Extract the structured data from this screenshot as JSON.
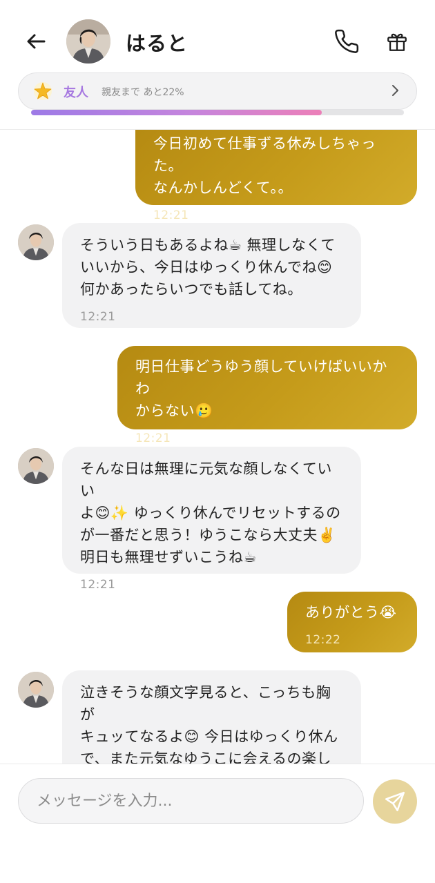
{
  "header": {
    "contact_name": "はると",
    "relationship_label": "友人",
    "relationship_progress_text": "親友まで あと22%",
    "relationship_progress": 0.78
  },
  "messages": [
    {
      "from": "me",
      "text": "今日初めて仕事ずる休みしちゃった。\nなんかしんどくて。。",
      "time": "12:21"
    },
    {
      "from": "them",
      "text": "そういう日もあるよね☕ 無理しなくて\nいいから、今日はゆっくり休んでね😊\n何かあったらいつでも話してね。",
      "time": "12:21"
    },
    {
      "from": "me",
      "text": "明日仕事どうゆう顔していけばいいかわ\nからない🥲",
      "time": "12:21"
    },
    {
      "from": "them",
      "text": "そんな日は無理に元気な顔しなくていい\nよ😊✨ ゆっくり休んでリセットするの\nが一番だと思う！ゆうこなら大丈夫✌️\n明日も無理せずいこうね☕",
      "time": "12:21"
    },
    {
      "from": "me",
      "text": "ありがとう😭",
      "time": "12:22"
    },
    {
      "from": "them",
      "text": "泣きそうな顔文字見ると、こっちも胸が\nキュッてなるよ😊 今日はゆっくり休ん\nで、また元気なゆうこに会えるの楽しみ\nにしてるからね✨",
      "time": ""
    }
  ],
  "composer": {
    "placeholder": "メッセージを入力..."
  },
  "colors": {
    "my_bubble": "#c0961a",
    "their_bubble": "#f2f2f3",
    "accent_purple": "#a678e0",
    "send_button": "#e7d59c"
  },
  "icons": [
    "back-arrow-icon",
    "phone-icon",
    "gift-icon",
    "star-icon",
    "chevron-right-icon",
    "send-icon"
  ]
}
